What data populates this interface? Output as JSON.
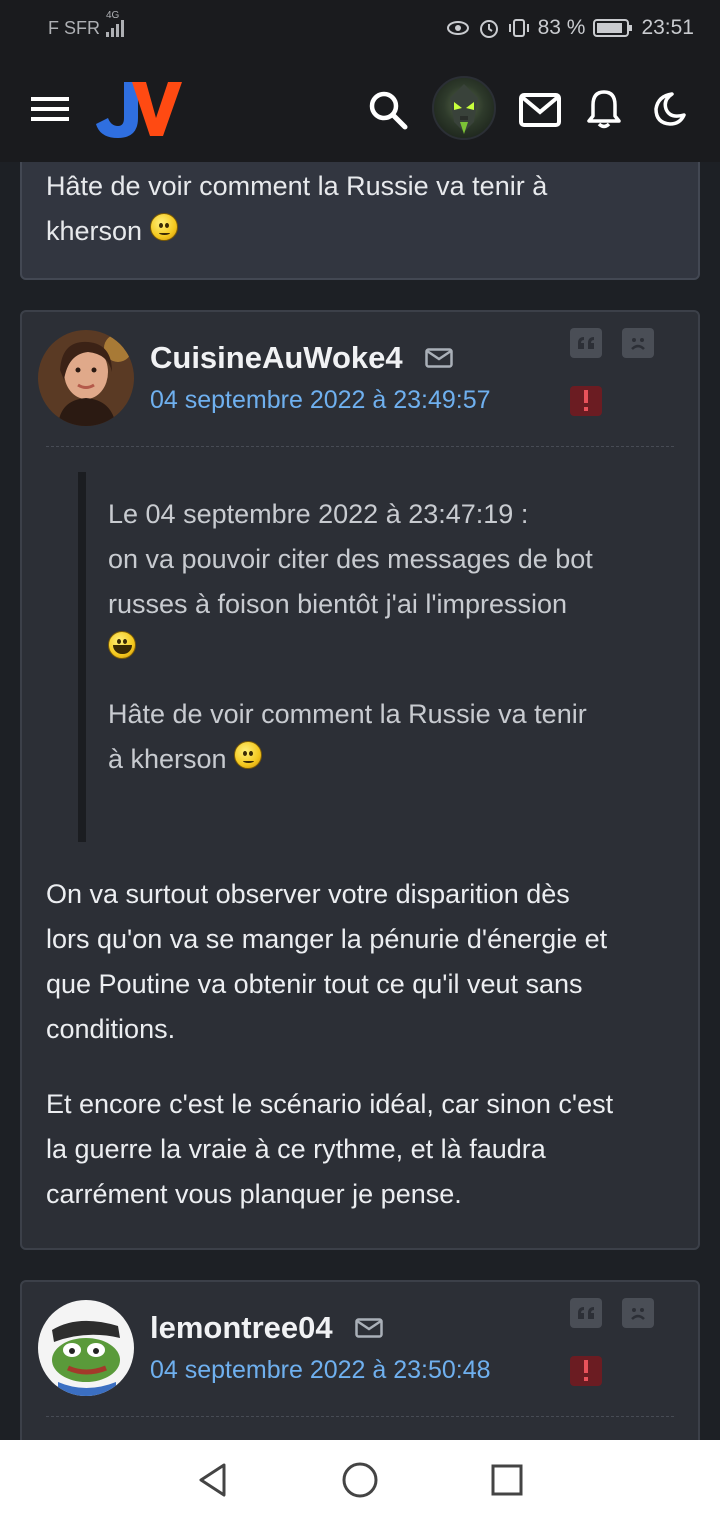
{
  "status_bar": {
    "carrier": "F SFR",
    "network": "4G",
    "battery": "83 %",
    "time": "23:51"
  },
  "header": {
    "menu_icon": "hamburger-menu-icon",
    "logo": "JV",
    "search_icon": "search-icon",
    "messages_icon": "mail-icon",
    "notifications_icon": "bell-icon",
    "theme_icon": "moon-icon"
  },
  "previous_post": {
    "text_line1": "Hâte de voir comment la Russie va tenir à",
    "text_line2": "kherson"
  },
  "posts": [
    {
      "pseudo": "CuisineAuWoke4",
      "date": "04 septembre 2022 à 23:49:57",
      "quote": {
        "header": "Le 04 septembre 2022 à 23:47:19 :",
        "line1": "on va pouvoir citer des messages de bot",
        "line2": "russes à foison bientôt j'ai l'impression",
        "line3": "Hâte de voir comment la Russie va tenir",
        "line4": "à kherson"
      },
      "paragraph1": [
        "On va surtout observer votre disparition dès",
        "lors qu'on va se manger la pénurie d'énergie et",
        "que Poutine va obtenir tout ce qu'il veut sans",
        "conditions."
      ],
      "paragraph2": [
        "Et encore c'est le scénario idéal, car sinon c'est",
        "la guerre la vraie à ce rythme, et là faudra",
        "carrément vous planquer je pense."
      ]
    },
    {
      "pseudo": "lemontree04",
      "date": "04 septembre 2022 à 23:50:48"
    }
  ],
  "colors": {
    "background": "#1d2025",
    "card": "#2c2f36",
    "link": "#6fb0ef",
    "logo_blue": "#2f6fe0",
    "logo_orange": "#ff4a12"
  }
}
